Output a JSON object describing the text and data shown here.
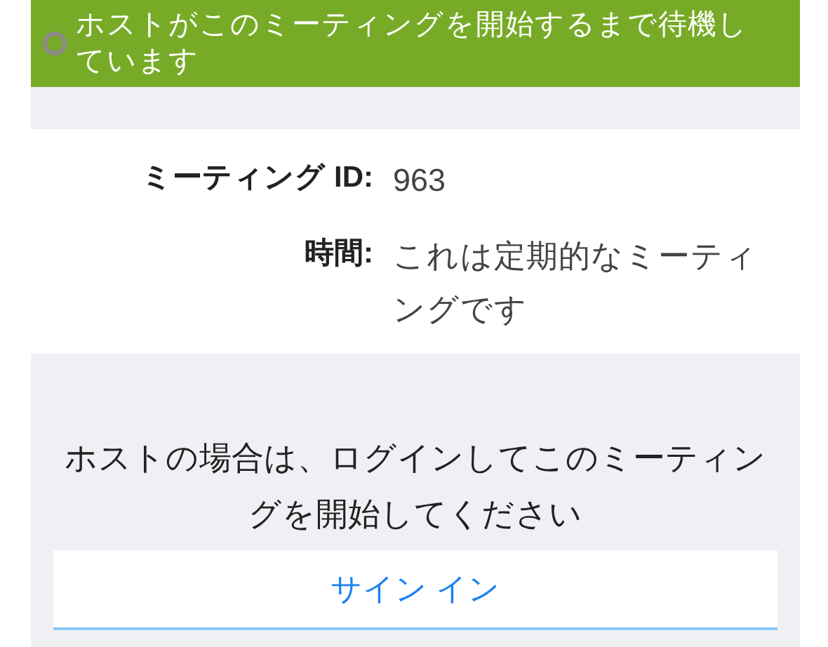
{
  "banner": {
    "text": "ホストがこのミーティングを開始するまで待機しています"
  },
  "details": [
    {
      "label": "ミーティング ID:",
      "value": "963"
    },
    {
      "label": "時間:",
      "value": "これは定期的なミーティングです"
    }
  ],
  "host_note": "ホストの場合は、ログインしてこのミーティングを開始してください",
  "sign_in_button": "サイン イン"
}
